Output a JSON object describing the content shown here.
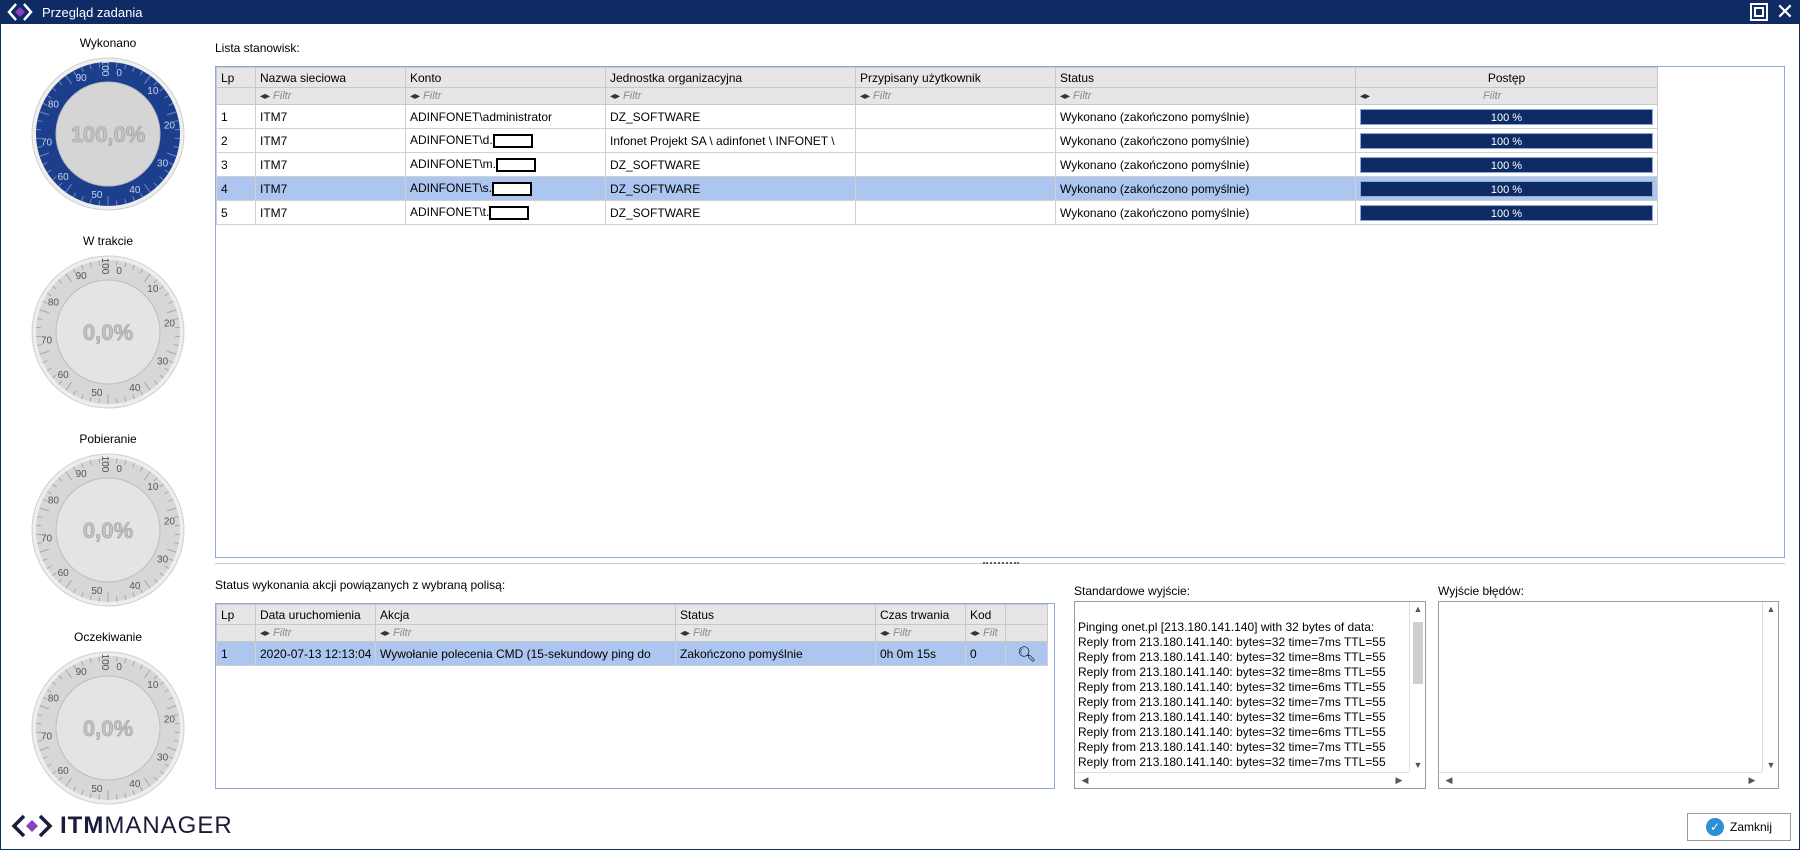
{
  "window": {
    "title": "Przegląd zadania",
    "maximize_icon": "maximize-icon",
    "close_icon": "close-icon"
  },
  "gauges": [
    {
      "label": "Wykonano",
      "value": 1.0,
      "text": "100,0%",
      "scale": [
        "0",
        "10",
        "20",
        "30",
        "40",
        "50",
        "60",
        "70",
        "80",
        "90",
        "100"
      ]
    },
    {
      "label": "W trakcie",
      "value": 0.0,
      "text": "0,0%"
    },
    {
      "label": "Pobieranie",
      "value": 0.0,
      "text": "0,0%"
    },
    {
      "label": "Oczekiwanie",
      "value": 0.0,
      "text": "0,0%"
    }
  ],
  "stations": {
    "section_label": "Lista stanowisk:",
    "columns": [
      "Lp",
      "Nazwa sieciowa",
      "Konto",
      "Jednostka organizacyjna",
      "Przypisany użytkownik",
      "Status",
      "Postęp"
    ],
    "filter_placeholder": "Filtr",
    "rows": [
      {
        "lp": "1",
        "name": "ITM7",
        "account": "ADINFONET\\administrator",
        "unit": "DZ_SOFTWARE",
        "user": "",
        "status": "Wykonano (zakończono pomyślnie)",
        "progress": 100,
        "progress_text": "100 %",
        "redacted": false
      },
      {
        "lp": "2",
        "name": "ITM7",
        "account": "ADINFONET\\d.",
        "unit": "Infonet Projekt SA \\ adinfonet \\ INFONET \\",
        "user": "",
        "status": "Wykonano (zakończono pomyślnie)",
        "progress": 100,
        "progress_text": "100 %",
        "redacted": true
      },
      {
        "lp": "3",
        "name": "ITM7",
        "account": "ADINFONET\\m.",
        "unit": "DZ_SOFTWARE",
        "user": "",
        "status": "Wykonano (zakończono pomyślnie)",
        "progress": 100,
        "progress_text": "100 %",
        "redacted": true
      },
      {
        "lp": "4",
        "name": "ITM7",
        "account": "ADINFONET\\s.",
        "unit": "DZ_SOFTWARE",
        "user": "",
        "status": "Wykonano (zakończono pomyślnie)",
        "progress": 100,
        "progress_text": "100 %",
        "redacted": true
      },
      {
        "lp": "5",
        "name": "ITM7",
        "account": "ADINFONET\\t.",
        "unit": "DZ_SOFTWARE",
        "user": "",
        "status": "Wykonano (zakończono pomyślnie)",
        "progress": 100,
        "progress_text": "100 %",
        "redacted": true
      }
    ],
    "selected_row": 3
  },
  "actions": {
    "section_label": "Status wykonania akcji powiązanych z wybraną polisą:",
    "columns": [
      "Lp",
      "Data uruchomienia",
      "Akcja",
      "Status",
      "Czas trwania",
      "Kod"
    ],
    "filter_placeholders": [
      "Filtr",
      "Filtr",
      "Filtr",
      "Filtr",
      "Filt"
    ],
    "rows": [
      {
        "lp": "1",
        "date": "2020-07-13 12:13:04",
        "action": "Wywołanie polecenia CMD (15-sekundowy ping do",
        "status": "Zakończono pomyślnie",
        "duration": "0h 0m 15s",
        "code": "0"
      }
    ]
  },
  "stdout": {
    "label": "Standardowe wyjście:",
    "lines": [
      "Pinging onet.pl [213.180.141.140] with 32 bytes of data:",
      "Reply from 213.180.141.140: bytes=32 time=7ms TTL=55",
      "Reply from 213.180.141.140: bytes=32 time=8ms TTL=55",
      "Reply from 213.180.141.140: bytes=32 time=8ms TTL=55",
      "Reply from 213.180.141.140: bytes=32 time=6ms TTL=55",
      "Reply from 213.180.141.140: bytes=32 time=7ms TTL=55",
      "Reply from 213.180.141.140: bytes=32 time=6ms TTL=55",
      "Reply from 213.180.141.140: bytes=32 time=6ms TTL=55",
      "Reply from 213.180.141.140: bytes=32 time=7ms TTL=55",
      "Reply from 213.180.141.140: bytes=32 time=7ms TTL=55"
    ]
  },
  "stderr": {
    "label": "Wyjście błędów:",
    "lines": []
  },
  "footer": {
    "brand_itm": "ITM",
    "brand_manager": "MANAGER",
    "close_label": "Zamknij"
  },
  "colors": {
    "navy": "#0f2b63",
    "selected": "#adc6ef",
    "accent": "#2d8fd5"
  }
}
